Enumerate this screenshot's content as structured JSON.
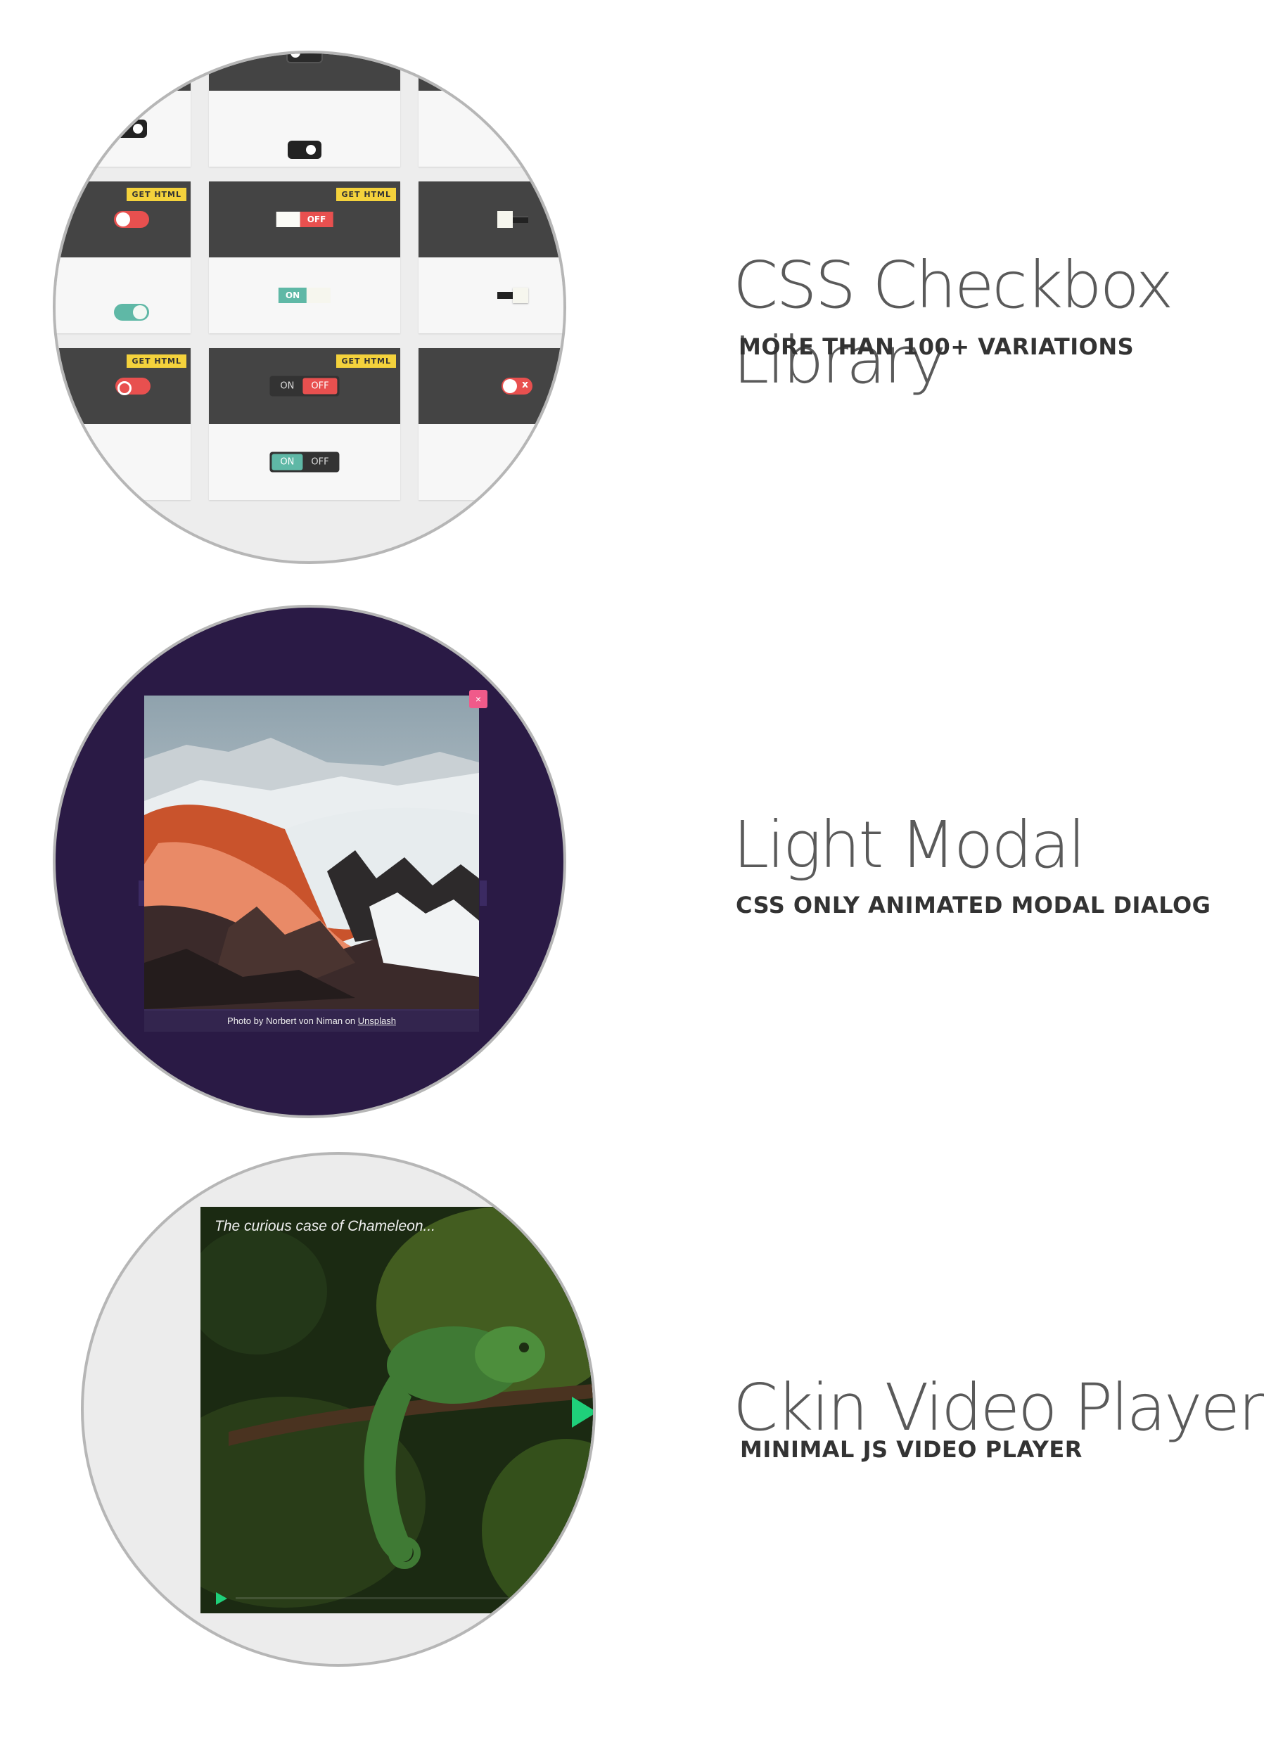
{
  "colors": {
    "accent_yellow": "#f4d23c",
    "toggle_red": "#e8504f",
    "toggle_teal": "#5fb8a6",
    "modal_bg": "#2a1a45",
    "play_green": "#1fd07a"
  },
  "checkbox_preview": {
    "get_html_label": "GET HTML",
    "labels": {
      "on": "ON",
      "off": "OFF",
      "x": "x"
    }
  },
  "modal_preview": {
    "close_icon": "×",
    "caption_prefix": "Photo by Norbert von Niman on",
    "caption_link": "Unsplash"
  },
  "video_preview": {
    "video_title": "The curious case of Chameleon...",
    "play_icon": "play-icon"
  },
  "products": [
    {
      "title": "CSS Checkbox Library",
      "subtitle": "MORE THAN 100+ VARIATIONS"
    },
    {
      "title": "Light Modal",
      "subtitle": "CSS ONLY ANIMATED MODAL DIALOG"
    },
    {
      "title": "Ckin Video Player",
      "subtitle": "MINIMAL JS VIDEO PLAYER"
    }
  ]
}
